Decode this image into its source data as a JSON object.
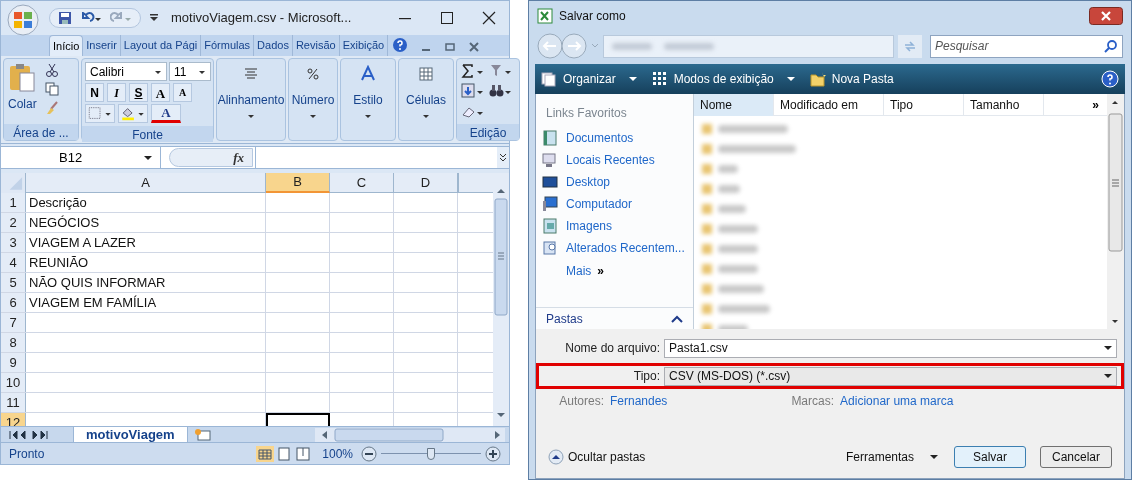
{
  "excel": {
    "title": "motivoViagem.csv - Microsoft...",
    "tabs": [
      {
        "label": "Início",
        "selected": true
      },
      {
        "label": "Inserir",
        "selected": false
      },
      {
        "label": "Layout da Pági",
        "selected": false
      },
      {
        "label": "Fórmulas",
        "selected": false
      },
      {
        "label": "Dados",
        "selected": false
      },
      {
        "label": "Revisão",
        "selected": false
      },
      {
        "label": "Exibição",
        "selected": false
      }
    ],
    "clipboard": {
      "paste": "Colar",
      "group": "Área de ..."
    },
    "font": {
      "name": "Calibri",
      "size": "11",
      "style_buttons": [
        "N",
        "I",
        "S"
      ],
      "grow": "A",
      "shrink": "A",
      "color_button": "A",
      "group": "Fonte"
    },
    "groups": [
      "Alinhamento",
      "Número",
      "Estilo",
      "Células"
    ],
    "editing_group": "Edição",
    "name_box": "B12",
    "function_label": "fx",
    "columns": [
      {
        "label": "A",
        "selected": false
      },
      {
        "label": "B",
        "selected": true
      },
      {
        "label": "C",
        "selected": false
      },
      {
        "label": "D",
        "selected": false
      }
    ],
    "rows": [
      {
        "number": "1",
        "value": "Descrição"
      },
      {
        "number": "2",
        "value": "NEGÓCIOS"
      },
      {
        "number": "3",
        "value": "VIAGEM A LAZER"
      },
      {
        "number": "4",
        "value": "REUNIÃO"
      },
      {
        "number": "5",
        "value": "NÃO QUIS INFORMAR"
      },
      {
        "number": "6",
        "value": "VIAGEM EM FAMÍLIA"
      },
      {
        "number": "7"
      },
      {
        "number": "8"
      },
      {
        "number": "9"
      },
      {
        "number": "10"
      },
      {
        "number": "11"
      },
      {
        "number": "12",
        "selected": true
      }
    ],
    "sheet_tab": "motivoViagem",
    "status": "Pronto",
    "zoom": "100%",
    "zoom_slider": {
      "level": 0.5
    }
  },
  "dialog": {
    "title": "Salvar como",
    "search": {
      "placeholder": "Pesquisar"
    },
    "toolbar": [
      {
        "kind": "menu",
        "label": "Organizar"
      },
      {
        "kind": "views",
        "label": "Modos de exibição"
      },
      {
        "kind": "folder",
        "label": "Nova Pasta"
      }
    ],
    "favorites_heading": "Links Favoritos",
    "favorites": [
      {
        "kind": "documents",
        "label": "Documentos"
      },
      {
        "kind": "recent",
        "label": "Locais Recentes"
      },
      {
        "kind": "desktop",
        "label": "Desktop"
      },
      {
        "kind": "computer",
        "label": "Computador"
      },
      {
        "kind": "pictures",
        "label": "Imagens"
      },
      {
        "kind": "search",
        "label": "Alterados Recentem..."
      }
    ],
    "more": "Mais",
    "more_glyph": "»",
    "folders": "Pastas",
    "columns": [
      "Nome",
      "Modificado em",
      "Tipo",
      "Tamanho"
    ],
    "columns_more": "»",
    "file_name": {
      "label": "Nome do arquivo:",
      "value": "Pasta1.csv"
    },
    "file_type": {
      "label": "Tipo:",
      "value": "CSV (MS-DOS) (*.csv)",
      "highlighted": true
    },
    "authors": {
      "label": "Autores:",
      "value": "Fernandes"
    },
    "tags": {
      "label": "Marcas:",
      "value": "Adicionar uma marca"
    },
    "hide_folders": "Ocultar pastas",
    "tools": "Ferramentas",
    "buttons": [
      {
        "label": "Salvar",
        "default": true
      },
      {
        "label": "Cancelar",
        "default": false
      }
    ]
  }
}
